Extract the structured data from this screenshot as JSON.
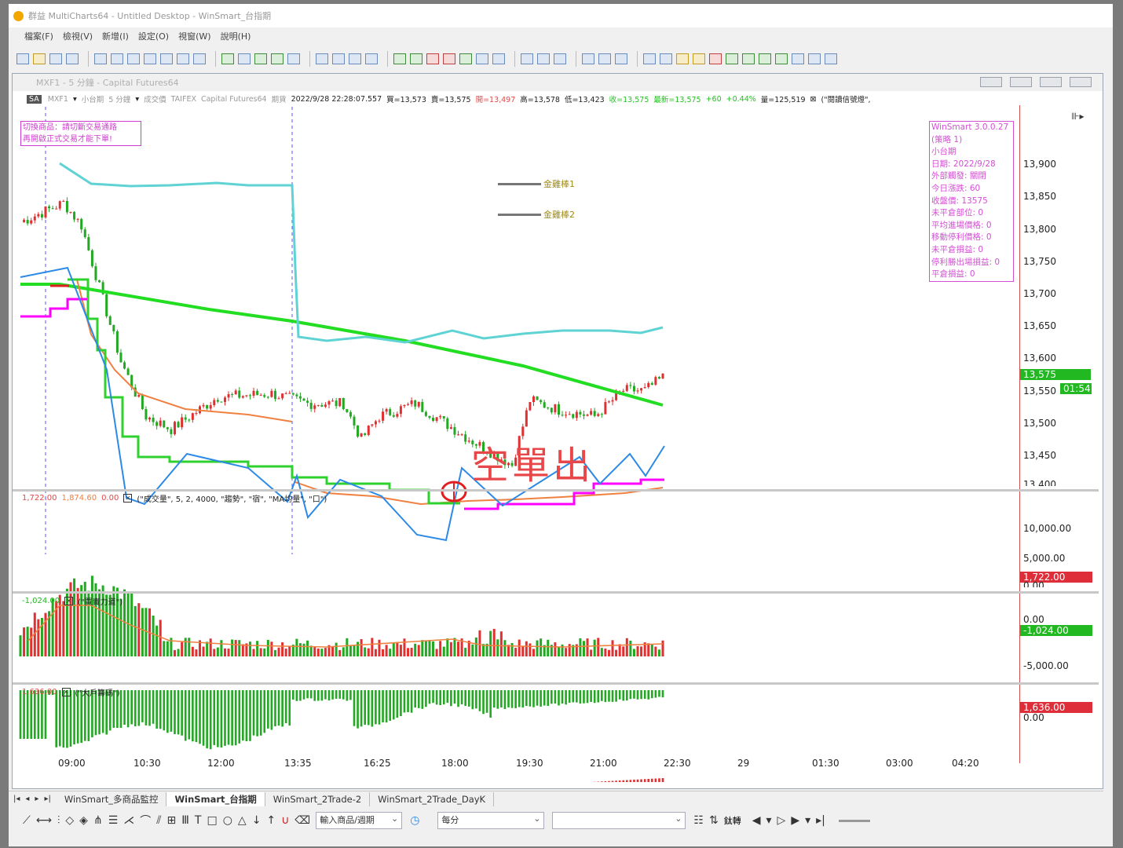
{
  "app": {
    "title": "群益 MultiCharts64 - Untitled Desktop - WinSmart_台指期",
    "menu": [
      "檔案(F)",
      "檢視(V)",
      "新增(I)",
      "設定(O)",
      "視窗(W)",
      "說明(H)"
    ]
  },
  "chart_window": {
    "title": "MXF1 - 5 分鐘 - Capital Futures64",
    "info": {
      "symbol_badge": "SA",
      "symbol": "MXF1",
      "name": "小台期",
      "interval": "5 分鐘",
      "data_type": "成交價",
      "exchange": "TAIFEX",
      "feed": "Capital Futures64",
      "period_label": "期貨",
      "datetime": "2022/9/28  22:28:07.557",
      "buy": "買=13,573",
      "sell": "賣=13,575",
      "open": "開=13,497",
      "high": "高=13,578",
      "low": "低=13,423",
      "close": "收=13,575",
      "last": "最新=13,575",
      "change": "+60",
      "change_pct": "+0.44%",
      "volume": "量=125,519",
      "study": "(\"閱讀信號燈\","
    },
    "warning": [
      "切換商品：請切斷交易通路",
      "再開啟正式交易才能下單!"
    ],
    "status_box": [
      "WinSmart 3.0.0.27",
      "(策略 1)",
      "小台期",
      "日期: 2022/9/28",
      "外部觸發: 關閉",
      "今日漲跌: 60",
      "收盤價: 13575",
      "未平倉部位: 0",
      "平均進場價格: 0",
      "移動停利價格: 0",
      "未平倉損益: 0",
      "停利勝出場損益: 0",
      "平倉損益: 0"
    ],
    "legend": [
      "金雞棒1",
      "金雞棒2"
    ],
    "annotation": "空單出",
    "price_axis": {
      "ticks": [
        "13,900",
        "13,850",
        "13,800",
        "13,750",
        "13,700",
        "13,650",
        "13,600",
        "13,550",
        "13,500",
        "13,450",
        "13,400"
      ],
      "last_price": "13,575",
      "countdown": "01:54"
    },
    "panels": {
      "volume": {
        "v1": "1,722.00",
        "v2": "1,874.60",
        "v3": "0.00",
        "title": "(\"成交量\", 5, 2, 4000, \"趨勢\", \"宿\", \"MA均量\", \"口\")",
        "ticks": [
          "10,000.00",
          "5,000.00",
          "0.00"
        ],
        "badge": "1,722.00"
      },
      "power": {
        "v1": "-1,024.00",
        "title": "(\"買賣力道\")",
        "ticks": [
          "0.00",
          "-5,000.00"
        ],
        "badge": "-1,024.00"
      },
      "major": {
        "v1": "1,636.00",
        "title": "(\"大戶籌碼\")",
        "ticks": [
          "0.00"
        ],
        "badge": "1,636.00"
      }
    },
    "time_axis": [
      "09:00",
      "10:30",
      "12:00",
      "13:35",
      "16:25",
      "18:00",
      "19:30",
      "21:00",
      "22:30",
      "29",
      "01:30",
      "03:00",
      "04:20"
    ]
  },
  "tabs": [
    "WinSmart_多商品監控",
    "WinSmart_台指期",
    "WinSmart_2Trade-2",
    "WinSmart_2Trade_DayK"
  ],
  "active_tab": "WinSmart_台指期",
  "bottom_toolbar": {
    "symbol_input": "輸入商品/週期",
    "interval_select": "每分",
    "trade_label": "鈦轉"
  },
  "colors": {
    "up": "#e03030",
    "down": "#22a822",
    "ma_long": "#22dd22",
    "cyan": "#5fd3d3",
    "orange": "#f08040",
    "zigzag": "#2c8ae6",
    "magenta": "#ff00ff",
    "trail": "#2fd12f"
  }
}
